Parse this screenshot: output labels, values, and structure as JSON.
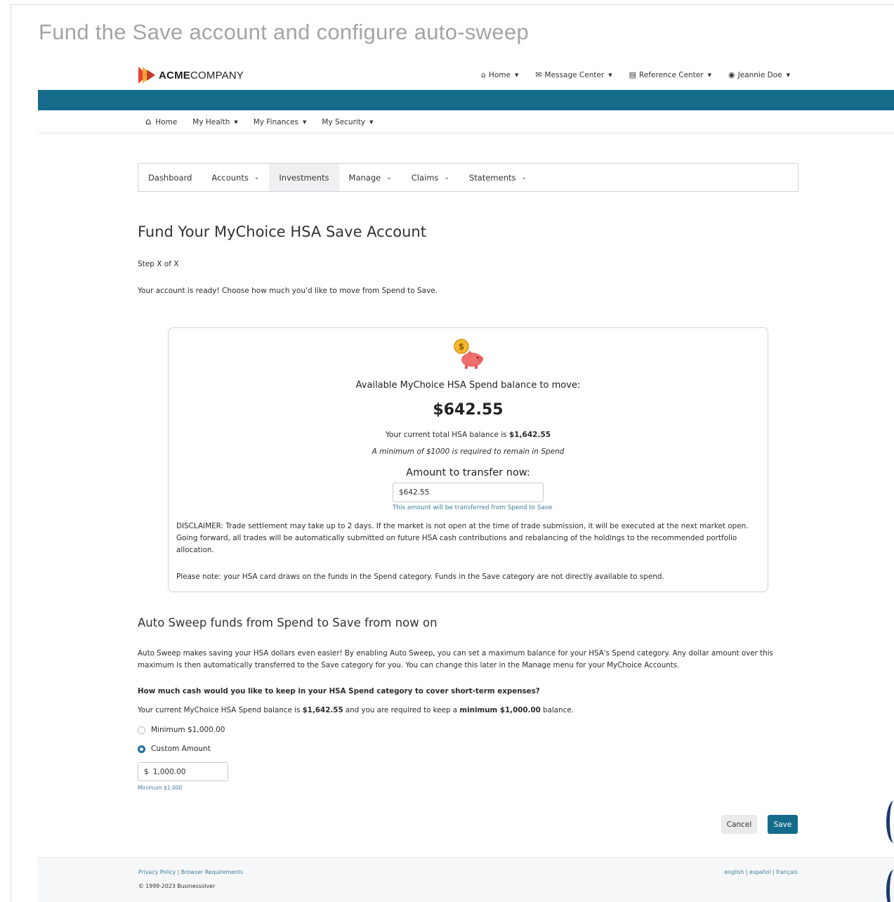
{
  "page_heading": "Fund the Save account and configure auto-sweep",
  "logo": {
    "bold": "ACME",
    "rest": "COMPANY"
  },
  "top_nav": [
    {
      "label": "Home",
      "icon": "home-icon"
    },
    {
      "label": "Message Center",
      "icon": "mail-icon"
    },
    {
      "label": "Reference Center",
      "icon": "book-icon"
    },
    {
      "label": "Jeannie Doe",
      "icon": "user-icon"
    }
  ],
  "main_nav": [
    {
      "label": "Home",
      "icon": "home-icon"
    },
    {
      "label": "My Health"
    },
    {
      "label": "My Finances"
    },
    {
      "label": "My Security"
    }
  ],
  "tabs": [
    {
      "label": "Dashboard"
    },
    {
      "label": "Accounts"
    },
    {
      "label": "Investments",
      "active": true
    },
    {
      "label": "Manage"
    },
    {
      "label": "Claims"
    },
    {
      "label": "Statements"
    }
  ],
  "title": "Fund Your MyChoice HSA Save Account",
  "step": "Step X of X",
  "intro": "Your account is ready! Choose how much you'd like to move from Spend to Save.",
  "card": {
    "title": "Available MyChoice HSA Spend balance to move:",
    "amount": "$642.55",
    "total_prefix": "Your current total HSA balance is ",
    "total_value": "$1,642.55",
    "minimum_note": "A minimum of $1000 is required to remain in Spend",
    "transfer_label": "Amount to transfer now:",
    "transfer_value": "$642.55",
    "transfer_hint": "This amount will be transferred from Spend to Save",
    "disclaimer": "DISCLAIMER: Trade settlement may take up to 2 days. If the market is not open at the time of trade submission, it will be executed at the next market open. Going forward, all trades will be automatically submitted on future HSA cash contributions and rebalancing of the holdings to the recommended portfolio allocation.",
    "note": "Please note: your HSA card draws on the funds in the Spend category. Funds in the Save category are not directly available to spend."
  },
  "sweep": {
    "title": "Auto Sweep funds from Spend to Save from now on",
    "description": "Auto Sweep makes saving your HSA dollars even easier! By enabling Auto Sweep, you can set a maximum balance for your HSA's Spend category. Any dollar amount over this maximum is then automatically transferred to the Save category for you. You can change this later in the Manage menu for your MyChoice Accounts.",
    "question": "How much cash would you like to keep in your HSA Spend category to cover short-term expenses?",
    "balance_1": "Your current MyChoice HSA Spend balance is ",
    "balance_value": "$1,642.55",
    "balance_2": " and you are required to keep a ",
    "balance_min": "minimum $1,000.00",
    "balance_3": " balance.",
    "option_min": "Minimum $1,000.00",
    "option_custom": "Custom Amount",
    "currency": "$",
    "custom_value": "1,000.00",
    "custom_hint": "Minimum $1,000"
  },
  "buttons": {
    "cancel": "Cancel",
    "save": "Save"
  },
  "footer": {
    "privacy": "Privacy Policy",
    "browser": "Browser Requirements",
    "copyright": "© 1999-2023 Businessolver",
    "sep": "|",
    "lang_en": "english",
    "lang_es": "español",
    "lang_fr": "français"
  },
  "colors": {
    "brand_teal": "#146b8a",
    "link": "#3c7e9b",
    "logo_red": "#e8423a",
    "logo_orange": "#f5a623"
  }
}
